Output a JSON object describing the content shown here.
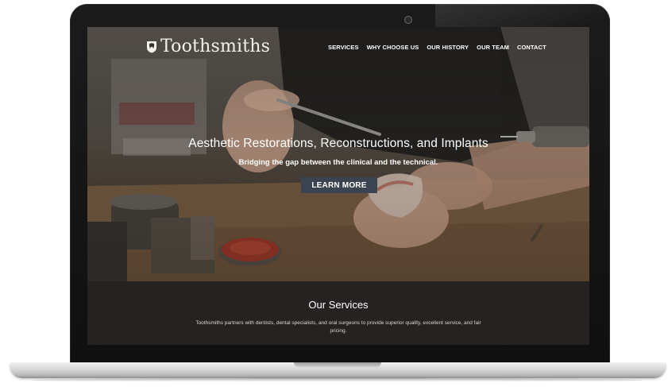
{
  "brand": {
    "name": "Toothsmiths",
    "logo_icon": "tooth-crest-icon"
  },
  "nav": {
    "items": [
      {
        "label": "SERVICES"
      },
      {
        "label": "WHY CHOOSE US"
      },
      {
        "label": "OUR HISTORY"
      },
      {
        "label": "OUR TEAM"
      },
      {
        "label": "CONTACT"
      }
    ]
  },
  "hero": {
    "title": "Aesthetic Restorations, Reconstructions, and Implants",
    "subtitle": "Bridging the gap between the clinical and the technical.",
    "cta_label": "LEARN MORE",
    "cta_color": "#3b4250"
  },
  "services": {
    "heading": "Our Services",
    "text": "Toothsmiths partners with dentists, dental specialists, and oral surgeons to provide superior quality, excellent service, and fair pricing."
  }
}
